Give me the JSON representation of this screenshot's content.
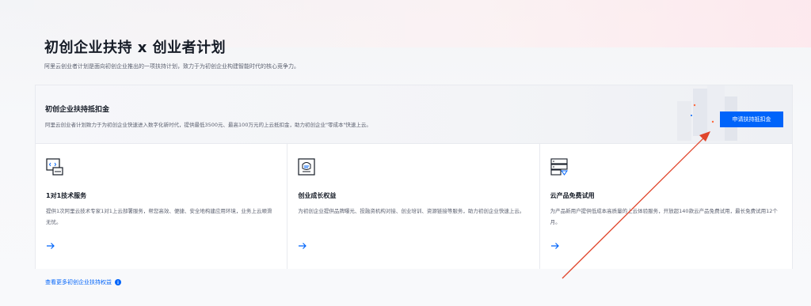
{
  "header": {
    "title": "初创企业扶持 x 创业者计划",
    "description": "阿里云创业者计划是面向初创企业推出的一项扶持计划，致力于为初创企业构建智能时代的核心竞争力。"
  },
  "banner": {
    "title": "初创企业扶持抵扣金",
    "description": "阿里云创业者计划致力于为初创企业快速进入数字化新时代，提供最低3500元、最高100万元的上云抵扣金，助力初创企业\"零成本\"快速上云。",
    "button_label": "申请扶持抵扣金"
  },
  "cards": [
    {
      "icon": "code-window-icon",
      "title": "1对1技术服务",
      "description": "提供1次阿里云技术专家1对1上云部署服务，帮您高效、便捷、安全地构建应用环境，业务上云顺滑无忧。"
    },
    {
      "icon": "growth-badge-icon",
      "title": "创业成长权益",
      "description": "为初创企业提供品牌曝光、投融资机构对接、创业培训、资源链接等服务，助力初创企业快速上云。"
    },
    {
      "icon": "cloud-product-icon",
      "title": "云产品免费试用",
      "description": "为产品新用户提供低成本高质量的上云体验服务，开放超140款云产品免费试用，最长免费试用12个月。"
    }
  ],
  "more_link": "查看更多初创企业扶持权益",
  "colors": {
    "accent": "#0064fa",
    "annotation_arrow": "#e0452b"
  }
}
